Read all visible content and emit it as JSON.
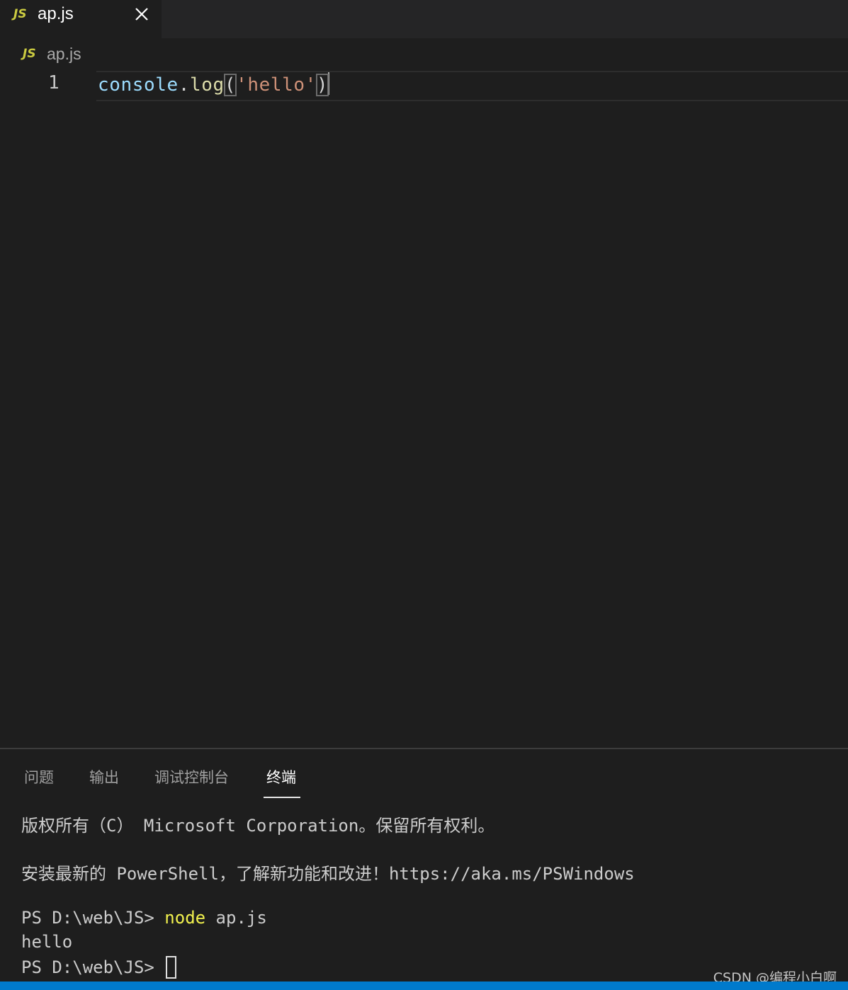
{
  "tab": {
    "badge": "JS",
    "label": "ap.js",
    "close_icon": "close-icon"
  },
  "breadcrumb": {
    "badge": "JS",
    "label": "ap.js"
  },
  "editor": {
    "line_number": "1",
    "tokens": {
      "object": "console",
      "dot": ".",
      "method": "log",
      "open_paren": "(",
      "string": "'hello'",
      "close_paren": ")"
    }
  },
  "panel": {
    "tabs": [
      {
        "label": "问题"
      },
      {
        "label": "输出"
      },
      {
        "label": "调试控制台"
      },
      {
        "label": "终端",
        "active": true
      }
    ]
  },
  "terminal": {
    "copyright": "版权所有（C） Microsoft Corporation。保留所有权利。",
    "install_hint": "安装最新的 PowerShell，了解新功能和改进！https://aka.ms/PSWindows",
    "prompt1": "PS D:\\web\\JS> ",
    "command": "node",
    "command_args": " ap.js",
    "output": "hello",
    "prompt2": "PS D:\\web\\JS> "
  },
  "watermark": "CSDN @编程小白啊",
  "colors": {
    "editor_bg": "#1e1e1e",
    "tabbar_bg": "#252526",
    "js_badge": "#cbcb41",
    "string": "#ce9178",
    "function": "#dcdcaa",
    "variable": "#9cdcfe",
    "terminal_command": "#f2f24e",
    "statusbar": "#007acc"
  }
}
